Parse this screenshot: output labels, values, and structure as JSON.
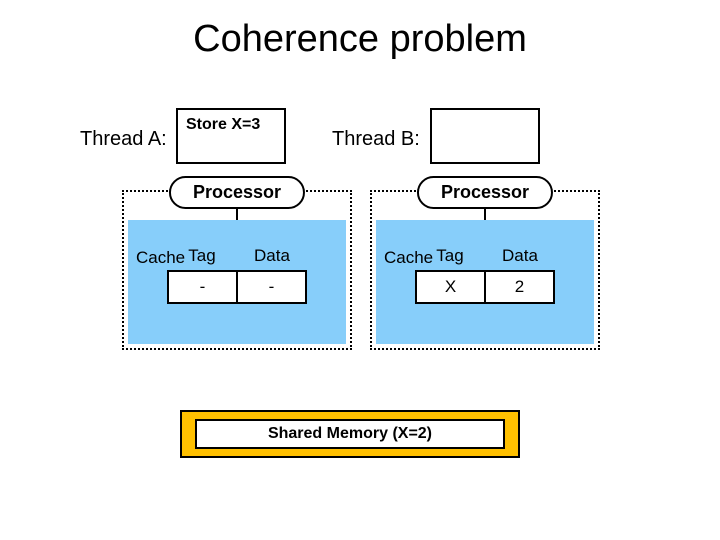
{
  "title": "Coherence problem",
  "threadA": {
    "label": "Thread A:",
    "code": "Store X=3"
  },
  "threadB": {
    "label": "Thread B:",
    "code": ""
  },
  "processor_label": "Processor",
  "cache_label": "Cache",
  "headers": {
    "tag": "Tag",
    "data": "Data"
  },
  "cacheA": {
    "tag": "-",
    "data": "-"
  },
  "cacheB": {
    "tag": "X",
    "data": "2"
  },
  "memory": "Shared Memory (X=2)"
}
